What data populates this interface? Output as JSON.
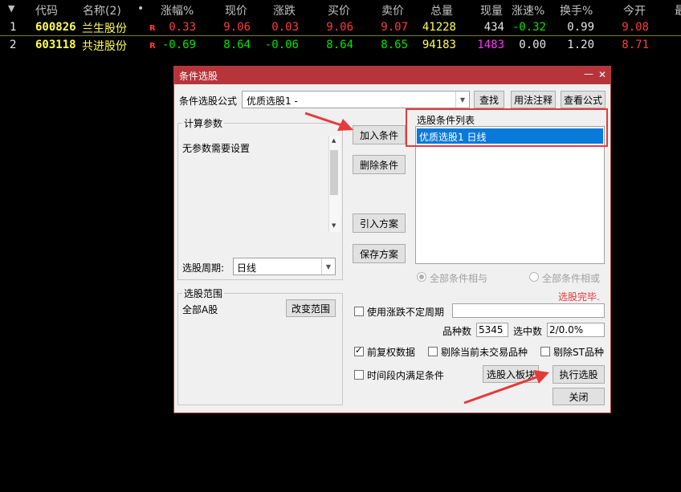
{
  "table": {
    "menu_glyph": "▼",
    "headers": [
      "代码",
      "名称(2)",
      "•",
      "涨幅%",
      "现价",
      "涨跌",
      "买价",
      "卖价",
      "总量",
      "现量",
      "涨速%",
      "换手%",
      "今开",
      "最"
    ],
    "rows": [
      {
        "idx": "1",
        "code": "600826",
        "name": "兰生股份",
        "badge": "R",
        "chg_pct": "0.33",
        "price": "9.06",
        "chg": "0.03",
        "bid": "9.06",
        "ask": "9.07",
        "vol": "41228",
        "cur": "434",
        "speed": "-0.32",
        "turnover": "0.99",
        "open": "9.08"
      },
      {
        "idx": "2",
        "code": "603118",
        "name": "共进股份",
        "badge": "R",
        "chg_pct": "-0.69",
        "price": "8.64",
        "chg": "-0.06",
        "bid": "8.64",
        "ask": "8.65",
        "vol": "94183",
        "cur": "1483",
        "speed": "0.00",
        "turnover": "1.20",
        "open": "8.71"
      }
    ]
  },
  "dialog": {
    "title": "条件选股",
    "minimize": "—",
    "close": "✕",
    "formula_label": "条件选股公式",
    "formula_value": "优质选股1  -",
    "find_btn": "查找",
    "usage_btn": "用法注释",
    "view_btn": "查看公式",
    "calc_params_title": "计算参数",
    "no_params_text": "无参数需要设置",
    "period_label": "选股周期:",
    "period_value": "日线",
    "range_title": "选股范围",
    "range_value": "全部A股",
    "change_range_btn": "改变范围",
    "add_btn": "加入条件",
    "delete_btn": "删除条件",
    "import_btn": "引入方案",
    "save_btn": "保存方案",
    "cond_list_title": "选股条件列表",
    "cond_items": [
      "优质选股1  日线"
    ],
    "radio_and": "全部条件相与",
    "radio_or": "全部条件相或",
    "status": "选股完毕.",
    "use_period_label": "使用涨跌不定周期",
    "count_label": "品种数",
    "count_value": "5345",
    "selected_label": "选中数",
    "selected_value": "2/0.0%",
    "fuquan_label": "前复权数据",
    "remove_untraded_label": "剔除当前未交易品种",
    "remove_st_label": "剔除ST品种",
    "time_cond_label": "时间段内满足条件",
    "to_block_btn": "选股入板块",
    "execute_btn": "执行选股",
    "close_btn": "关闭",
    "colors": {
      "title_bar": "#b7343a",
      "highlight": "#0a7ad8",
      "annotation": "#e53a3a"
    }
  }
}
